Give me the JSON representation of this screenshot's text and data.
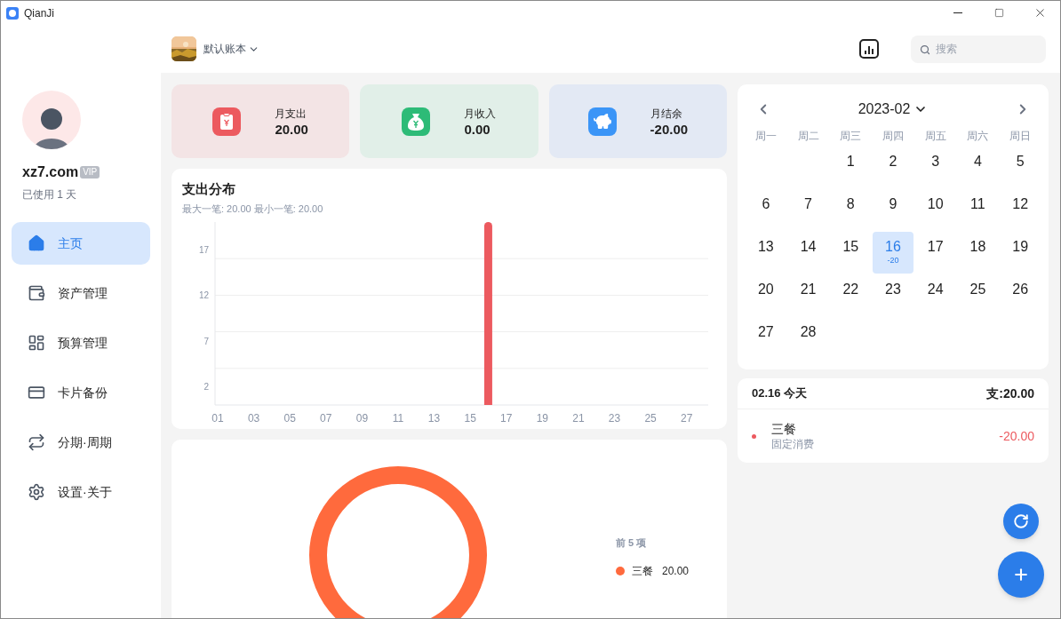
{
  "window": {
    "title": "QianJi"
  },
  "profile": {
    "name": "xz7.com",
    "badge": "VIP",
    "usage": "已使用 1 天"
  },
  "sidebar": {
    "items": [
      {
        "label": "主页",
        "selected": true
      },
      {
        "label": "资产管理",
        "selected": false
      },
      {
        "label": "预算管理",
        "selected": false
      },
      {
        "label": "卡片备份",
        "selected": false
      },
      {
        "label": "分期·周期",
        "selected": false
      },
      {
        "label": "设置·关于",
        "selected": false
      }
    ]
  },
  "header": {
    "book": "默认账本",
    "search": {
      "placeholder": "搜索"
    }
  },
  "summary": [
    {
      "kind": "expense",
      "label": "月支出",
      "value": "20.00"
    },
    {
      "kind": "income",
      "label": "月收入",
      "value": "0.00"
    },
    {
      "kind": "balance",
      "label": "月结余",
      "value": "-20.00"
    }
  ],
  "distribution": {
    "title": "支出分布",
    "subtitle": "最大一笔: 20.00 最小一笔: 20.00",
    "chart_data": {
      "type": "bar",
      "x": [
        16
      ],
      "series": [
        {
          "color": "#ec5a5f",
          "values": [
            20
          ]
        }
      ],
      "xlim": [
        0.85,
        28.2
      ],
      "ylim": [
        0,
        20
      ],
      "yticks": [
        2,
        7,
        12,
        17
      ],
      "xticks": [
        {
          "value": 1,
          "label": "01"
        },
        {
          "value": 3,
          "label": "03"
        },
        {
          "value": 5,
          "label": "05"
        },
        {
          "value": 7,
          "label": "07"
        },
        {
          "value": 9,
          "label": "09"
        },
        {
          "value": 11,
          "label": "11"
        },
        {
          "value": 13,
          "label": "13"
        },
        {
          "value": 15,
          "label": "15"
        },
        {
          "value": 17,
          "label": "17"
        },
        {
          "value": 19,
          "label": "19"
        },
        {
          "value": 21,
          "label": "21"
        },
        {
          "value": 23,
          "label": "23"
        },
        {
          "value": 25,
          "label": "25"
        },
        {
          "value": 27,
          "label": "27"
        }
      ]
    }
  },
  "category_share": {
    "legend_title": "前 5 项",
    "legend": [
      {
        "label": "三餐",
        "amount": "20.00",
        "color": "#ff6a3d"
      }
    ]
  },
  "calendar": {
    "month": "2023-02",
    "weekdays": [
      "周一",
      "周二",
      "周三",
      "周四",
      "周五",
      "周六",
      "周日"
    ],
    "weeks": [
      [
        {
          "label": "1",
          "selected": false
        },
        {
          "label": "2",
          "selected": false
        },
        {
          "label": "3",
          "selected": false
        },
        {
          "label": "4",
          "selected": false
        },
        {
          "label": "5",
          "selected": false
        }
      ],
      [
        {
          "label": "6",
          "selected": false
        },
        {
          "label": "7",
          "selected": false
        },
        {
          "label": "8",
          "selected": false
        },
        {
          "label": "9",
          "selected": false
        },
        {
          "label": "10",
          "selected": false
        },
        {
          "label": "11",
          "selected": false
        },
        {
          "label": "12",
          "selected": false
        }
      ],
      [
        {
          "label": "13",
          "selected": false
        },
        {
          "label": "14",
          "selected": false
        },
        {
          "label": "15",
          "selected": false
        },
        {
          "label": "16",
          "selected": true,
          "note": "-20"
        },
        {
          "label": "17",
          "selected": false
        },
        {
          "label": "18",
          "selected": false
        },
        {
          "label": "19",
          "selected": false
        }
      ],
      [
        {
          "label": "20",
          "selected": false
        },
        {
          "label": "21",
          "selected": false
        },
        {
          "label": "22",
          "selected": false
        },
        {
          "label": "23",
          "selected": false
        },
        {
          "label": "24",
          "selected": false
        },
        {
          "label": "25",
          "selected": false
        },
        {
          "label": "26",
          "selected": false
        }
      ],
      [
        {
          "label": "27",
          "selected": false
        },
        {
          "label": "28",
          "selected": false
        }
      ]
    ]
  },
  "day_detail": {
    "date": "02.16 今天",
    "total": "支:20.00",
    "entries": [
      {
        "name": "三餐",
        "category": "固定消费",
        "amount": "-20.00",
        "color": "#ec5a5f"
      }
    ]
  }
}
